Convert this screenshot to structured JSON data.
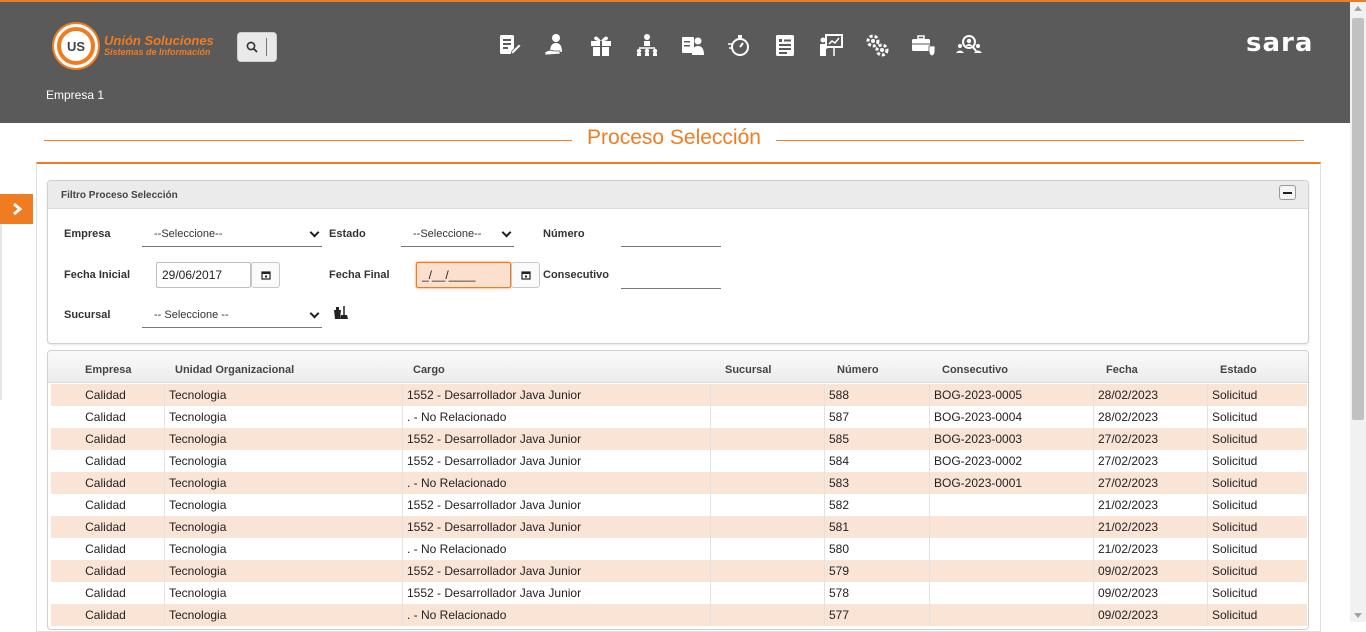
{
  "header": {
    "logo_line1": "Unión Soluciones",
    "logo_line2": "Sistemas de Información",
    "logo_mark": "US",
    "brand": "sara",
    "company": "Empresa 1",
    "nav_icons": [
      "document-edit-icon",
      "person-hand-icon",
      "gift-icon",
      "org-chart-icon",
      "id-card-person-icon",
      "stopwatch-icon",
      "list-document-icon",
      "presentation-icon",
      "gears-icon",
      "briefcase-shield-icon",
      "group-search-icon"
    ],
    "accent": "#f07c22",
    "bg": "#5a5a5a"
  },
  "page": {
    "title": "Proceso Selección"
  },
  "filter": {
    "title": "Filtro Proceso Selección",
    "empresa_label": "Empresa",
    "empresa_value": "--Seleccione--",
    "estado_label": "Estado",
    "estado_value": "--Seleccione--",
    "numero_label": "Número",
    "fecha_inicial_label": "Fecha Inicial",
    "fecha_inicial_value": "29/06/2017",
    "fecha_final_label": "Fecha Final",
    "fecha_final_value": "_/__/____",
    "consecutivo_label": "Consecutivo",
    "sucursal_label": "Sucursal",
    "sucursal_value": "-- Seleccione --"
  },
  "table": {
    "columns": [
      "Empresa",
      "Unidad Organizacional",
      "Cargo",
      "Sucursal",
      "Número",
      "Consecutivo",
      "Fecha",
      "Estado"
    ],
    "rows": [
      [
        "Calidad",
        "Tecnologia",
        "1552 - Desarrollador Java Junior",
        "",
        "588",
        "BOG-2023-0005",
        "28/02/2023",
        "Solicitud"
      ],
      [
        "Calidad",
        "Tecnologia",
        ". - No Relacionado",
        "",
        "587",
        "BOG-2023-0004",
        "28/02/2023",
        "Solicitud"
      ],
      [
        "Calidad",
        "Tecnologia",
        "1552 - Desarrollador Java Junior",
        "",
        "585",
        "BOG-2023-0003",
        "27/02/2023",
        "Solicitud"
      ],
      [
        "Calidad",
        "Tecnologia",
        "1552 - Desarrollador Java Junior",
        "",
        "584",
        "BOG-2023-0002",
        "27/02/2023",
        "Solicitud"
      ],
      [
        "Calidad",
        "Tecnologia",
        ". - No Relacionado",
        "",
        "583",
        "BOG-2023-0001",
        "27/02/2023",
        "Solicitud"
      ],
      [
        "Calidad",
        "Tecnologia",
        "1552 - Desarrollador Java Junior",
        "",
        "582",
        "",
        "21/02/2023",
        "Solicitud"
      ],
      [
        "Calidad",
        "Tecnologia",
        "1552 - Desarrollador Java Junior",
        "",
        "581",
        "",
        "21/02/2023",
        "Solicitud"
      ],
      [
        "Calidad",
        "Tecnologia",
        ". - No Relacionado",
        "",
        "580",
        "",
        "21/02/2023",
        "Solicitud"
      ],
      [
        "Calidad",
        "Tecnologia",
        "1552 - Desarrollador Java Junior",
        "",
        "579",
        "",
        "09/02/2023",
        "Solicitud"
      ],
      [
        "Calidad",
        "Tecnologia",
        "1552 - Desarrollador Java Junior",
        "",
        "578",
        "",
        "09/02/2023",
        "Solicitud"
      ],
      [
        "Calidad",
        "Tecnologia",
        ". - No Relacionado",
        "",
        "577",
        "",
        "09/02/2023",
        "Solicitud"
      ]
    ],
    "row_odd_color": "#fae4d6"
  }
}
